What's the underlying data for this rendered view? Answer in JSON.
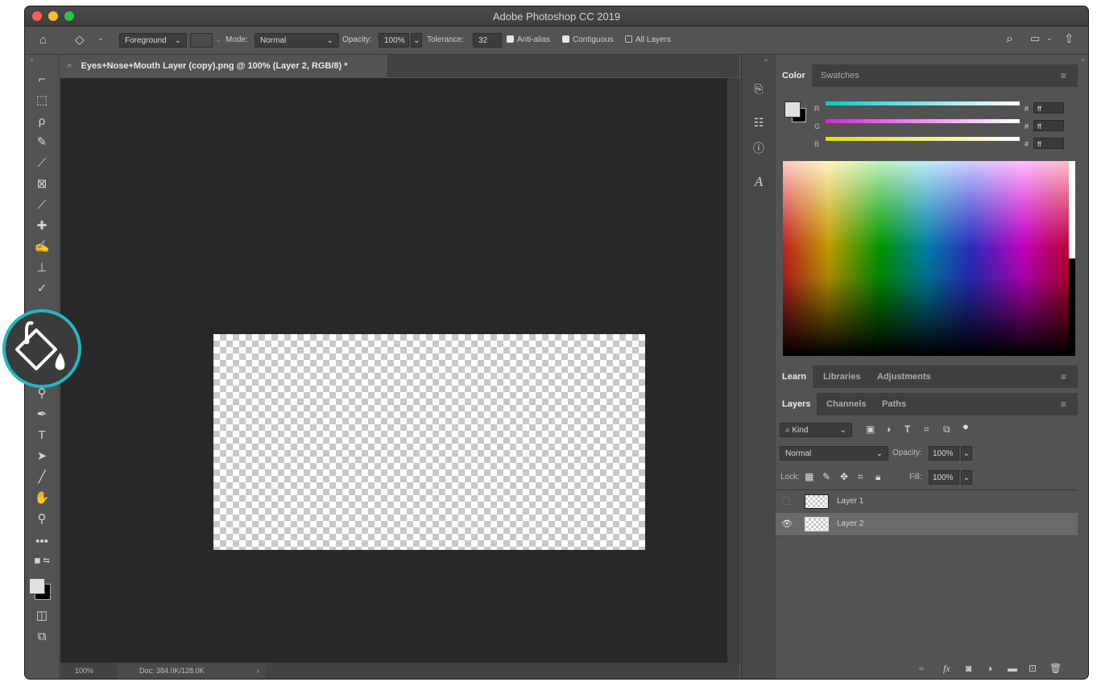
{
  "window": {
    "title": "Adobe Photoshop CC 2019"
  },
  "options_bar": {
    "fill_source": "Foreground",
    "mode_label": "Mode:",
    "mode_value": "Normal",
    "opacity_label": "Opacity:",
    "opacity_value": "100%",
    "tolerance_label": "Tolerance:",
    "tolerance_value": "32",
    "anti_alias_label": "Anti-alias",
    "anti_alias_checked": true,
    "contiguous_label": "Contiguous",
    "contiguous_checked": true,
    "all_layers_label": "All Layers",
    "all_layers_checked": false
  },
  "document": {
    "tab_close": "×",
    "tab_title": "Eyes+Nose+Mouth Layer (copy).png @ 100% (Layer 2, RGB/8) *",
    "zoom": "100%",
    "doc_size": "Doc: 384.0K/128.0K"
  },
  "color_panel": {
    "tabs": [
      "Color",
      "Swatches"
    ],
    "channels": [
      {
        "label": "R",
        "hash": "#",
        "value": "ff",
        "color": "#00c8c8"
      },
      {
        "label": "G",
        "hash": "#",
        "value": "ff",
        "color": "#e020e0"
      },
      {
        "label": "B",
        "hash": "#",
        "value": "ff",
        "color": "#e0e000"
      }
    ]
  },
  "learn_panel": {
    "tabs": [
      "Learn",
      "Libraries",
      "Adjustments"
    ]
  },
  "layers_panel": {
    "tabs": [
      "Layers",
      "Channels",
      "Paths"
    ],
    "filter_kind": "Kind",
    "blend_mode": "Normal",
    "opacity_label": "Opacity:",
    "opacity_value": "100%",
    "lock_label": "Lock:",
    "fill_label": "Fill:",
    "fill_value": "100%",
    "layers": [
      {
        "name": "Layer 1",
        "visible": false,
        "selected": false
      },
      {
        "name": "Layer 2",
        "visible": true,
        "selected": true
      }
    ]
  },
  "colors": {
    "accent_highlight": "#22b8c2",
    "foreground": "#e0e0e0",
    "background": "#000000"
  }
}
